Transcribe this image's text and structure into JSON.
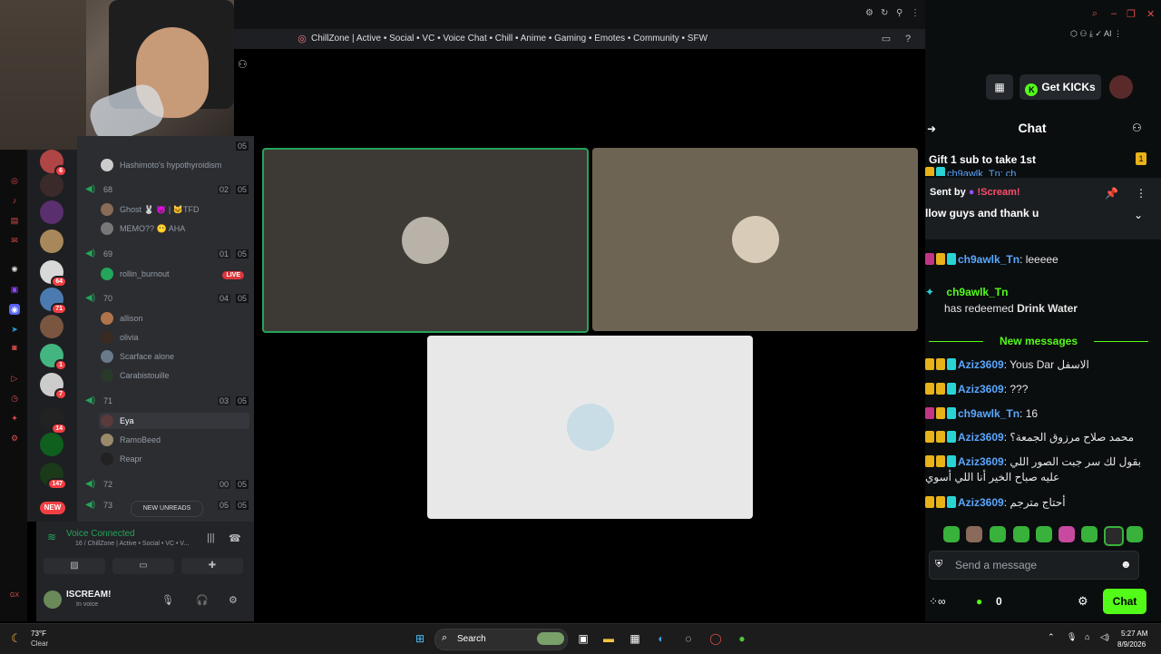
{
  "discord": {
    "window_title": "ChillZone | Active • Social • VC • Voice Chat • Chill • Anime • Gaming • Emotes • Community • SFW",
    "server_badges": [
      "6",
      "64",
      "71",
      "1",
      "7",
      "14",
      "147"
    ],
    "new_pill": "NEW",
    "voice_channels": [
      {
        "name": "68",
        "count": "02",
        "limit": "05",
        "users": [
          {
            "name": "Ghost 🐰 😈 | 🐱TFD"
          },
          {
            "name": "MEMO?? 😶 AHA"
          }
        ]
      },
      {
        "name": "69",
        "count": "01",
        "limit": "05",
        "users": [
          {
            "name": "rollin_burnout",
            "live": "LIVE"
          }
        ]
      },
      {
        "name": "70",
        "count": "04",
        "limit": "05",
        "users": [
          {
            "name": "allison"
          },
          {
            "name": "olivia"
          },
          {
            "name": "Scarface alone"
          },
          {
            "name": "Carabistouille"
          }
        ]
      },
      {
        "name": "71",
        "count": "03",
        "limit": "05",
        "users": [
          {
            "name": "Eya"
          },
          {
            "name": "RamoBeed"
          },
          {
            "name": "Reapr"
          }
        ]
      },
      {
        "name": "72",
        "count": "00",
        "limit": "05",
        "users": []
      },
      {
        "name": "73",
        "count": "05",
        "limit": "05",
        "users": []
      }
    ],
    "top_user": "Hashimoto's hypothyroidism",
    "top_limit": "05",
    "new_unreads": "NEW UNREADS",
    "voice_status": "Voice Connected",
    "voice_channel": "16 / ChillZone | Active • Social • VC • V...",
    "me_name": "ISCREAM!",
    "me_status": "In voice"
  },
  "kick": {
    "get_kicks": "Get KICKs",
    "chat_title": "Chat",
    "gift_banner": "Gift 1 sub to take 1st",
    "gift_count": "1",
    "partial_top": "ch9awlk_Tn: ch",
    "sent_by_label": "Sent by",
    "sent_by_name": "!Scream!",
    "pinned_message": "llow guys and thank u",
    "messages_before": [
      {
        "user": "ch9awlk_Tn",
        "text": ": leeeee"
      }
    ],
    "redeem_user": "ch9awlk_Tn",
    "redeem_prefix": "has redeemed ",
    "redeem_item": "Drink Water",
    "new_messages": "New messages",
    "messages": [
      {
        "user": "Aziz3609",
        "text": ": Yous Dar الاسفل"
      },
      {
        "user": "Aziz3609",
        "text": ": ???"
      },
      {
        "user": "ch9awlk_Tn",
        "text": ": 16"
      },
      {
        "user": "Aziz3609",
        "text": ": محمد صلاح مرزوق الجمعة؟"
      },
      {
        "user": "Aziz3609",
        "text": ": بقول لك سر جبت الصور اللي"
      },
      {
        "user": "",
        "text": "عليه صباح الخير أنا اللي أسوي"
      },
      {
        "user": "Aziz3609",
        "text": ": أحتاج مترجم"
      }
    ],
    "send_placeholder": "Send a message",
    "kicks_count": "0",
    "chat_button": "Chat"
  },
  "taskbar": {
    "temp": "73°F",
    "weather": "Clear",
    "search": "Search",
    "time": "5:27 AM",
    "date": "8/9/2026"
  },
  "colors": {
    "accent_green": "#53fc18",
    "discord_green": "#23a55a",
    "tile1": "#3d3a36",
    "tile2": "#6e6454",
    "tile3": "#e8e8e8"
  }
}
